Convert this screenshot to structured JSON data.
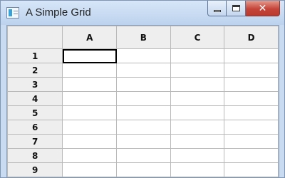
{
  "window": {
    "title": "A Simple Grid",
    "controls": {
      "minimize": "—",
      "maximize": "□",
      "close": "✕"
    }
  },
  "grid": {
    "columns": [
      "A",
      "B",
      "C",
      "D"
    ],
    "rows": [
      "1",
      "2",
      "3",
      "4",
      "5",
      "6",
      "7",
      "8",
      "9"
    ],
    "selected_cell": "A1",
    "cells": [
      [
        "",
        "",
        "",
        ""
      ],
      [
        "",
        "",
        "",
        ""
      ],
      [
        "",
        "",
        "",
        ""
      ],
      [
        "",
        "",
        "",
        ""
      ],
      [
        "",
        "",
        "",
        ""
      ],
      [
        "",
        "",
        "",
        ""
      ],
      [
        "",
        "",
        "",
        ""
      ],
      [
        "",
        "",
        "",
        ""
      ],
      [
        "",
        "",
        "",
        ""
      ]
    ]
  },
  "colors": {
    "titlebar": "#c9dbf0",
    "header_bg": "#eeeeee",
    "grid_line": "#b9b9b9",
    "close_button": "#c5443a"
  },
  "icons": {
    "app": "app-window-icon",
    "minimize": "minimize-icon",
    "maximize": "maximize-icon",
    "close": "close-icon"
  }
}
